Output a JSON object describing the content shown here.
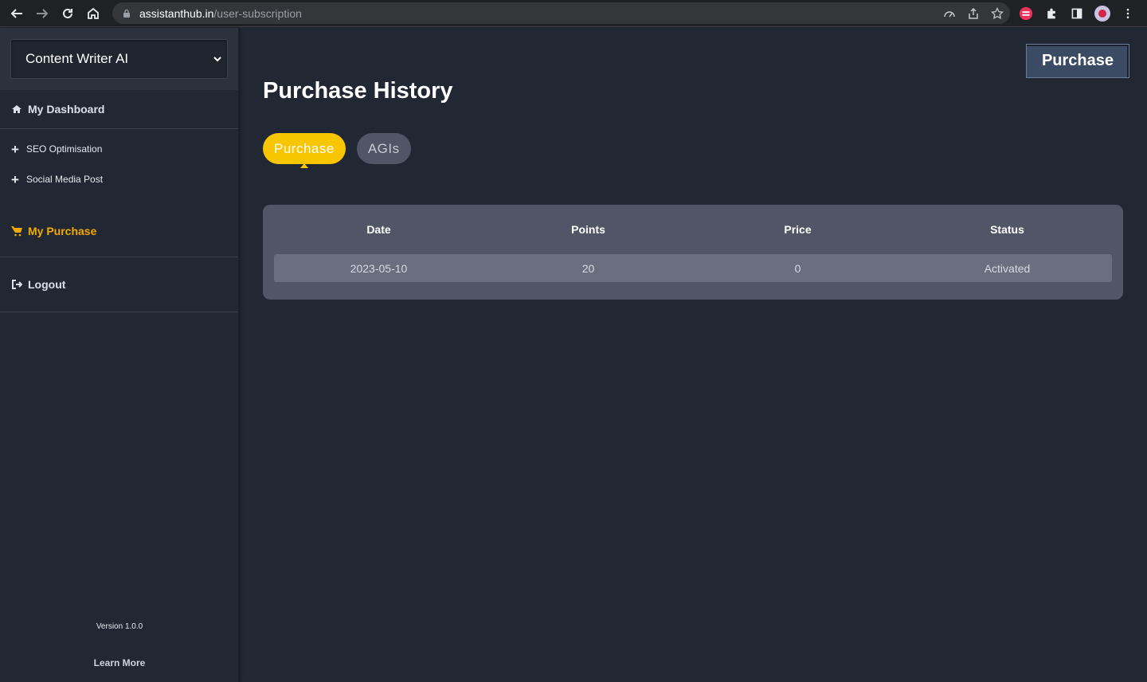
{
  "browser": {
    "url_domain": "assistanthub.in",
    "url_path": "/user-subscription"
  },
  "sidebar": {
    "selected_app": "Content Writer AI",
    "items": [
      {
        "label": "My Dashboard"
      },
      {
        "label": "SEO Optimisation"
      },
      {
        "label": "Social Media Post"
      },
      {
        "label": "My Purchase"
      },
      {
        "label": "Logout"
      }
    ],
    "version": "Version 1.0.0",
    "learn_more": "Learn More"
  },
  "main": {
    "purchase_button": "Purchase",
    "title": "Purchase History",
    "tabs": [
      {
        "label": "Purchase",
        "active": true
      },
      {
        "label": "AGIs",
        "active": false
      }
    ],
    "table": {
      "headers": [
        "Date",
        "Points",
        "Price",
        "Status"
      ],
      "rows": [
        [
          "2023-05-10",
          "20",
          "0",
          "Activated"
        ]
      ]
    }
  },
  "colors": {
    "accent": "#f7c600",
    "active_menu": "#f2a900",
    "background": "#212733"
  }
}
